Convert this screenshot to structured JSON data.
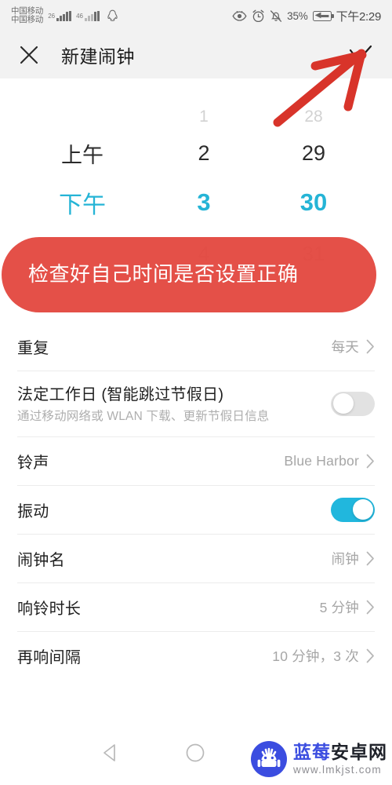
{
  "status_bar": {
    "carrier_line1": "中国移动",
    "carrier_line2": "中国移动",
    "net_type_1": "26",
    "net_type_2": "46",
    "icons": [
      "eye-comfort-icon",
      "alarm-icon",
      "mute-icon",
      "qq-icon"
    ],
    "battery_percent": "35%",
    "battery_state": "charging",
    "clock": "下午2:29"
  },
  "app_bar": {
    "close_label": "✕",
    "title": "新建闹钟",
    "confirm_label": "✓"
  },
  "time_picker": {
    "columns": [
      {
        "name": "ampm",
        "values": [
          "",
          "上午",
          "下午",
          ""
        ],
        "selected": "下午"
      },
      {
        "name": "hour",
        "values": [
          "1",
          "2",
          "3",
          "4"
        ],
        "selected": "3"
      },
      {
        "name": "minute",
        "values": [
          "28",
          "29",
          "30",
          "31"
        ],
        "selected": "30"
      }
    ],
    "selected_time": "下午 3:30",
    "accent_color": "#25b4d6"
  },
  "annotation": {
    "banner_text": "检查好自己时间是否设置正确",
    "banner_color": "#e2433a",
    "arrow_color": "#d8342a",
    "arrow_target": "confirm-check-button"
  },
  "settings": {
    "rows": [
      {
        "key": "repeat",
        "label": "重复",
        "value": "每天",
        "type": "chevron"
      },
      {
        "key": "workday",
        "label": "法定工作日 (智能跳过节假日)",
        "sub": "通过移动网络或 WLAN 下载、更新节假日信息",
        "type": "toggle",
        "toggle_on": false
      },
      {
        "key": "ringtone",
        "label": "铃声",
        "value": "Blue Harbor",
        "type": "chevron"
      },
      {
        "key": "vibrate",
        "label": "振动",
        "type": "toggle",
        "toggle_on": true
      },
      {
        "key": "alarm-name",
        "label": "闹钟名",
        "value": "闹钟",
        "type": "chevron"
      },
      {
        "key": "ring-duration",
        "label": "响铃时长",
        "value": "5 分钟",
        "type": "chevron"
      },
      {
        "key": "snooze",
        "label": "再响间隔",
        "value": "10 分钟，3 次",
        "type": "chevron"
      }
    ]
  },
  "nav_bar": {
    "back_label": "back-triangle-icon",
    "home_label": "home-circle-icon"
  },
  "watermark": {
    "title_blue": "蓝莓",
    "title_dark": "安卓网",
    "url": "www.lmkjst.com"
  }
}
